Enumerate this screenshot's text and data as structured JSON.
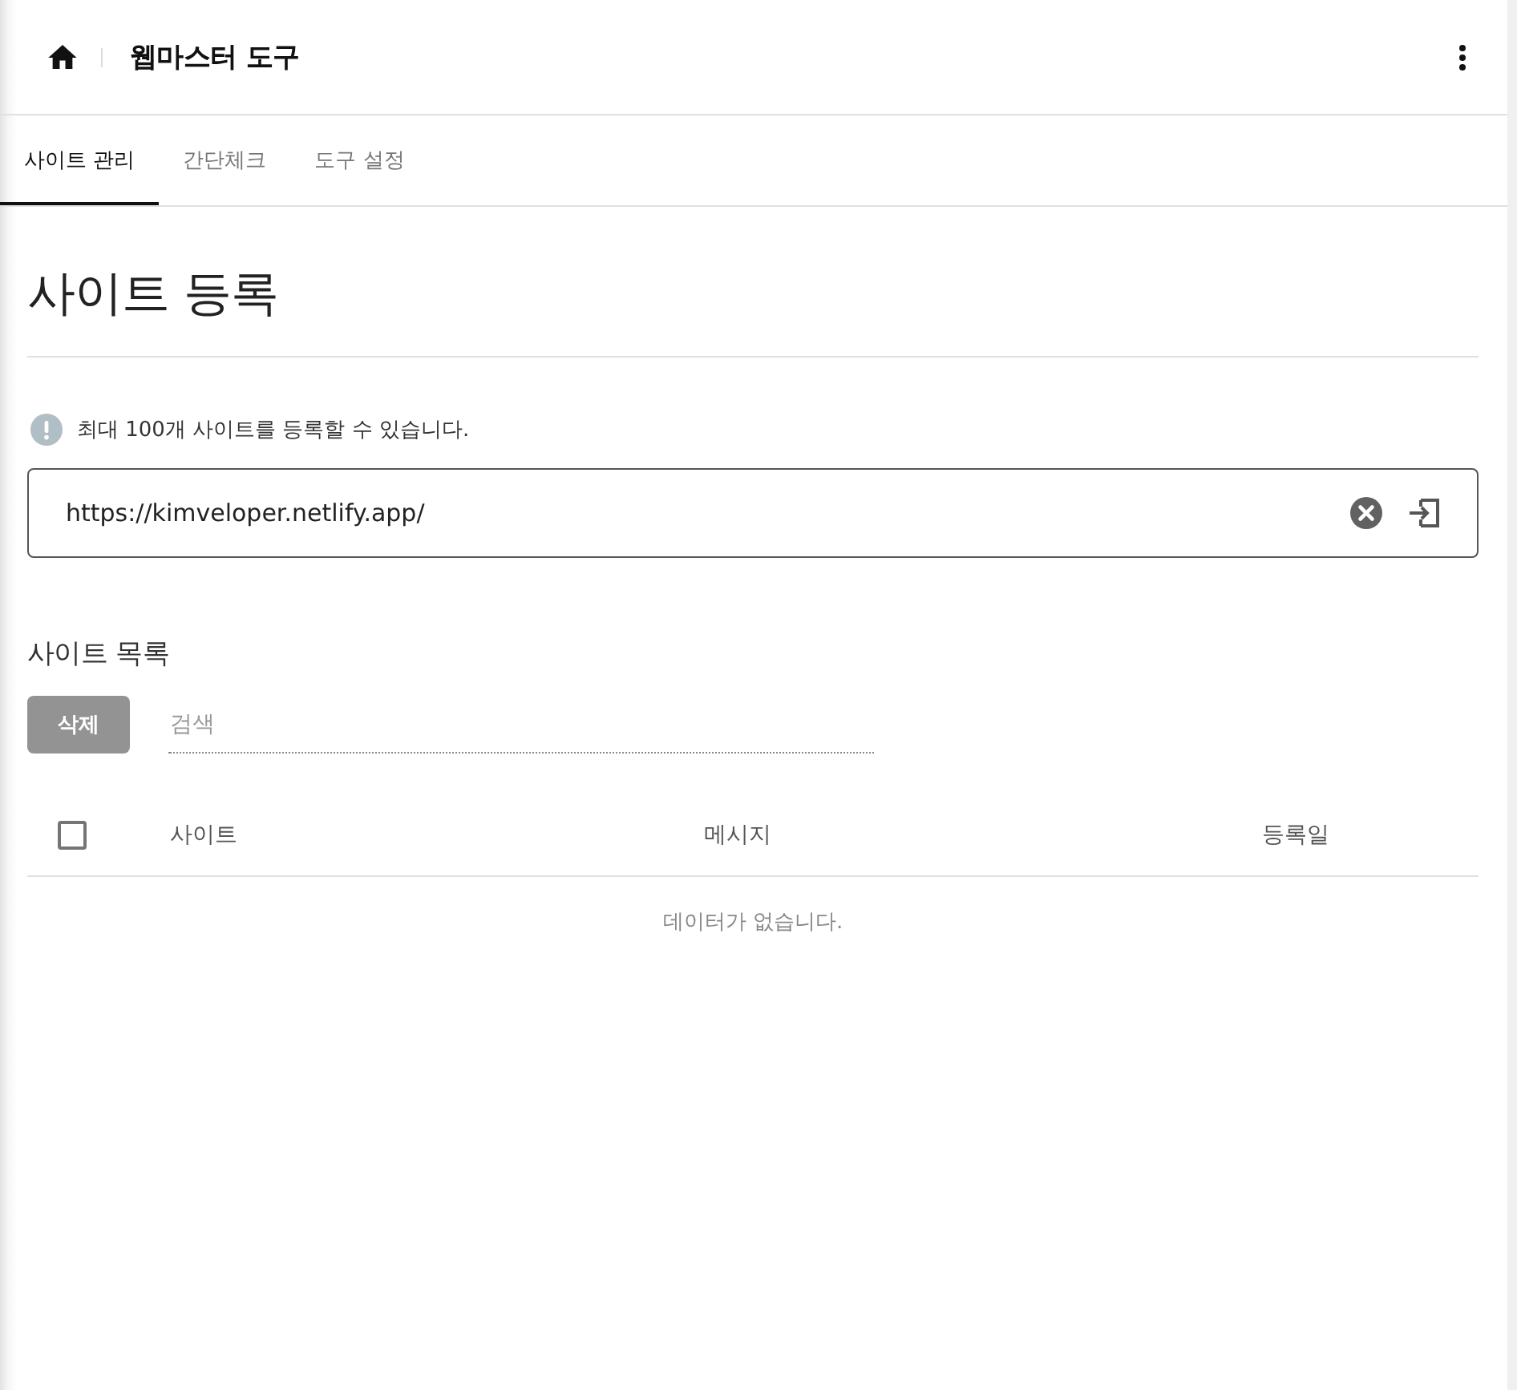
{
  "header": {
    "title": "웹마스터 도구"
  },
  "tabs": [
    {
      "label": "사이트 관리",
      "selected": true
    },
    {
      "label": "간단체크",
      "selected": false
    },
    {
      "label": "도구 설정",
      "selected": false
    }
  ],
  "registration": {
    "heading": "사이트 등록",
    "notice": "최대 100개 사이트를 등록할 수 있습니다.",
    "url_field": {
      "value": "https://kimveloper.netlify.app/"
    }
  },
  "site_list": {
    "heading": "사이트 목록",
    "delete_button": {
      "label": "삭제",
      "disabled": true
    },
    "search": {
      "placeholder": "검색"
    },
    "table": {
      "select_all": {
        "checked": false
      },
      "columns": [
        "사이트",
        "메시지",
        "등록일"
      ],
      "empty_message": "데이터가 없습니다."
    }
  }
}
